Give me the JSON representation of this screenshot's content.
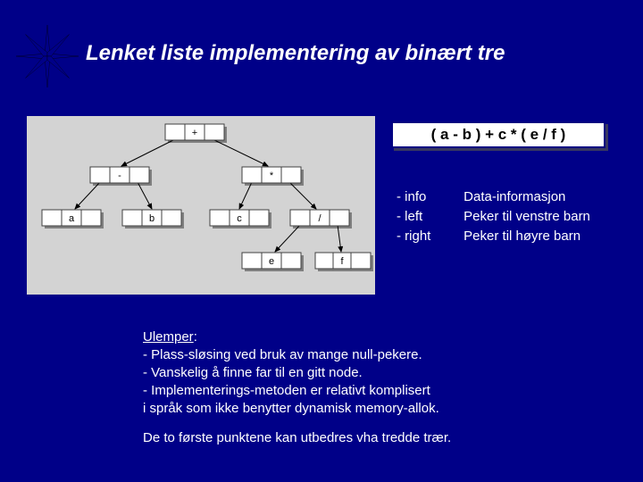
{
  "title": "Lenket liste implementering av binært tre",
  "expression": "( a - b ) + c * ( e / f )",
  "tree": {
    "root": "+",
    "left_op": "-",
    "right_op": "*",
    "a": "a",
    "b": "b",
    "c": "c",
    "slash": "/",
    "e": "e",
    "f": "f"
  },
  "terms": [
    {
      "bullet": "-  ",
      "label": "info",
      "desc": "Data-informasjon"
    },
    {
      "bullet": "-  ",
      "label": "left",
      "desc": "Peker til venstre barn"
    },
    {
      "bullet": "-  ",
      "label": "right",
      "desc": "Peker til høyre barn"
    }
  ],
  "disadv": {
    "heading": "Ulemper",
    "colon": ":",
    "items": [
      "-  Plass-sløsing ved bruk av mange null-pekere.",
      "-  Vanskelig å finne far til en gitt node.",
      "-  Implementerings-metoden er relativt komplisert",
      "   i språk som ikke benytter dynamisk memory-allok."
    ]
  },
  "footer": "De to første punktene kan utbedres vha tredde trær."
}
